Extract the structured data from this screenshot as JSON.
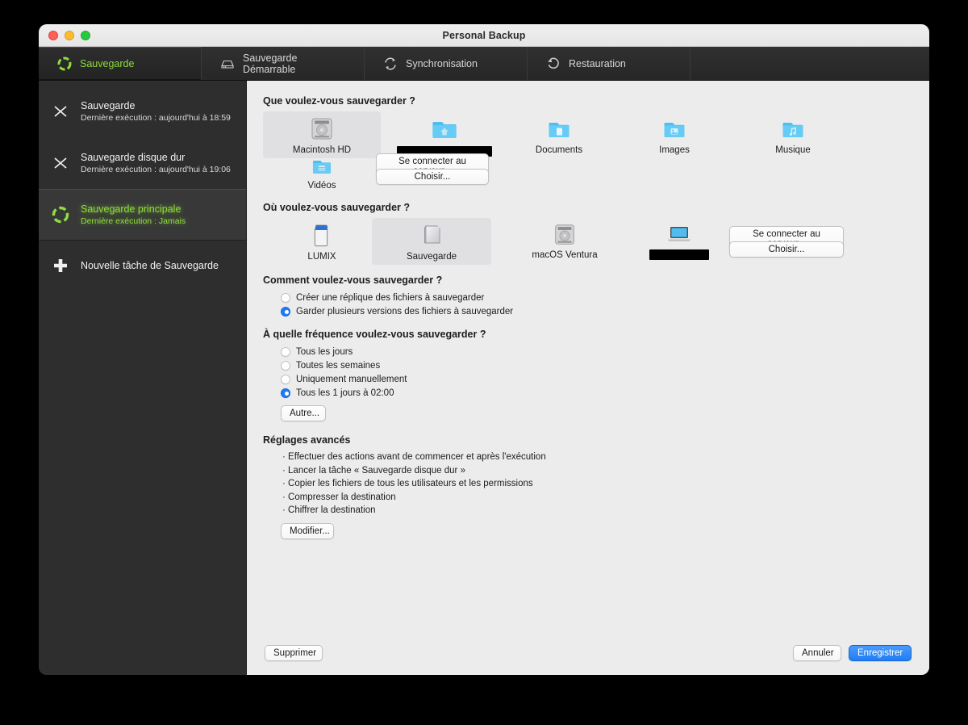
{
  "window": {
    "title": "Personal Backup",
    "traffic_lights": [
      "close-button",
      "minimize-button",
      "zoom-button"
    ]
  },
  "tabs": [
    {
      "label": "Sauvegarde",
      "icon": "backup-circle-icon",
      "active": true
    },
    {
      "label": "Sauvegarde Démarrable",
      "icon": "external-drive-icon",
      "active": false
    },
    {
      "label": "Synchronisation",
      "icon": "sync-arrows-icon",
      "active": false
    },
    {
      "label": "Restauration",
      "icon": "restore-arrow-icon",
      "active": false
    }
  ],
  "sidebar": {
    "tasks": [
      {
        "name": "Sauvegarde",
        "sub": "Dernière exécution : aujourd'hui à 18:59",
        "icon": "x-mark-icon",
        "selected": false
      },
      {
        "name": "Sauvegarde disque dur",
        "sub": "Dernière exécution : aujourd'hui à 19:06",
        "icon": "x-mark-icon",
        "selected": false
      },
      {
        "name": "Sauvegarde principale",
        "sub": "Dernière exécution : Jamais",
        "icon": "backup-circle-icon",
        "selected": true
      }
    ],
    "new_task": {
      "label": "Nouvelle tâche de Sauvegarde",
      "icon": "plus-icon"
    }
  },
  "main": {
    "source": {
      "title": "Que voulez-vous sauvegarder ?",
      "items": [
        {
          "label": "Macintosh HD",
          "icon": "internal-hard-drive-icon",
          "selected": true,
          "redacted": false
        },
        {
          "label": "",
          "icon": "home-folder-icon",
          "selected": false,
          "redacted": true
        },
        {
          "label": "Documents",
          "icon": "documents-folder-icon",
          "selected": false,
          "redacted": false
        },
        {
          "label": "Images",
          "icon": "pictures-folder-icon",
          "selected": false,
          "redacted": false
        },
        {
          "label": "Musique",
          "icon": "music-folder-icon",
          "selected": false,
          "redacted": false
        },
        {
          "label": "Vidéos",
          "icon": "movies-folder-icon",
          "selected": false,
          "redacted": false
        }
      ],
      "connect_server_label": "Se connecter au serveur...",
      "choose_label": "Choisir..."
    },
    "destination": {
      "title": "Où voulez-vous sauvegarder ?",
      "items": [
        {
          "label": "LUMIX",
          "icon": "sd-card-icon",
          "selected": false,
          "redacted": false
        },
        {
          "label": "Sauvegarde",
          "icon": "external-drive-icon",
          "selected": true,
          "redacted": false
        },
        {
          "label": "macOS Ventura",
          "icon": "internal-hard-drive-icon",
          "selected": false,
          "redacted": false
        },
        {
          "label": "",
          "icon": "laptop-icon",
          "selected": false,
          "redacted": true
        }
      ],
      "connect_server_label": "Se connecter au serveur...",
      "choose_label": "Choisir..."
    },
    "how": {
      "title": "Comment voulez-vous sauvegarder ?",
      "options": [
        {
          "label": "Créer une réplique des fichiers à sauvegarder",
          "selected": false
        },
        {
          "label": "Garder plusieurs versions des fichiers à sauvegarder",
          "selected": true
        }
      ]
    },
    "frequency": {
      "title": "À quelle fréquence voulez-vous sauvegarder ?",
      "options": [
        {
          "label": "Tous les jours",
          "selected": false
        },
        {
          "label": "Toutes les semaines",
          "selected": false
        },
        {
          "label": "Uniquement manuellement",
          "selected": false
        },
        {
          "label": "Tous les 1 jours à 02:00",
          "selected": true
        }
      ],
      "other_button": "Autre..."
    },
    "advanced": {
      "title": "Réglages avancés",
      "items": [
        "Effectuer des actions avant de commencer et après l'exécution",
        "Lancer la tâche « Sauvegarde disque dur »",
        "Copier les fichiers de tous les utilisateurs et les permissions",
        "Compresser la destination",
        "Chiffrer la destination"
      ],
      "edit_button": "Modifier..."
    }
  },
  "footer": {
    "delete_label": "Supprimer",
    "cancel_label": "Annuler",
    "save_label": "Enregistrer"
  },
  "colors": {
    "accent_blue": "#1f7df4",
    "accent_green": "#8ede3c",
    "folder_blue": "#5cc3f2",
    "pane_bg": "#ececed",
    "sidebar_bg": "#2e2e2e"
  }
}
